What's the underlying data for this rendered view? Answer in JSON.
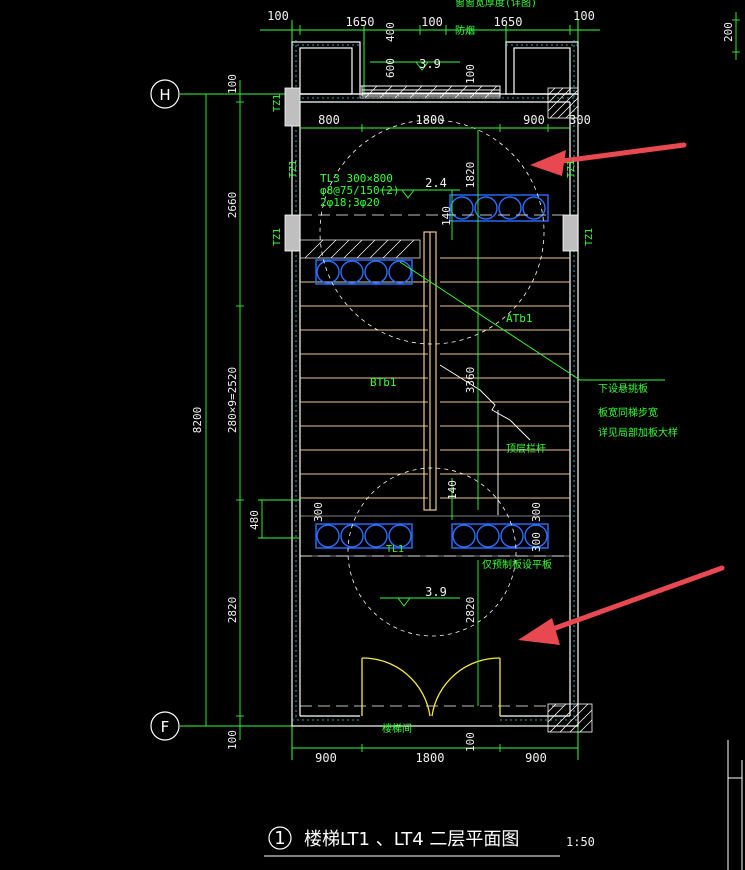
{
  "drawing": {
    "title_number": "1",
    "title": "楼梯LT1 、LT4  二层平面图",
    "scale": "1:50"
  },
  "axes": {
    "top": "H",
    "bottom": "F"
  },
  "top_dims": [
    "100",
    "1650",
    "100",
    "1650",
    "100"
  ],
  "top_inner_dims": [
    "800",
    "1800",
    "900",
    "300"
  ],
  "bottom_dims": [
    "900",
    "1800",
    "900"
  ],
  "left_dims": {
    "total": "8200",
    "top_100": "100",
    "seg1": "2660",
    "seg2": "280×9=2520",
    "seg3": "2820",
    "bottom_100": "100",
    "small": "480"
  },
  "window_dims": [
    "400",
    "600",
    "100"
  ],
  "right_dim": "200",
  "elevations": {
    "top": "3.9",
    "landing": "2.4",
    "bottom": "3.9"
  },
  "center_dims": [
    "1820",
    "3360",
    "2820",
    "100"
  ],
  "flight_dims": [
    "140",
    "140",
    "300",
    "300",
    "300"
  ],
  "beam_note": [
    "TL3 300×800",
    "φ8@75/150(2)",
    "2φ18;3φ20"
  ],
  "labels": {
    "atb": "ATb1",
    "btb": "BTb1",
    "tl1": "TL1",
    "tz1": "TZ1",
    "note1": "下设悬挑板",
    "note2": "板宽同梯步宽",
    "note3": "详见局部加板大样",
    "handrail": "顶层栏杆",
    "floor_note": "仅预制板设平板",
    "bottom_wall": "楼梯间",
    "top_partial": "窗窗宽厚度(详图)",
    "window_label": "防烟"
  },
  "colors": {
    "wall": "#ffffff",
    "dim": "#33ff33",
    "stair": "#e8c98a",
    "circle": "#2a6fff",
    "arrow": "#e8484f",
    "text": "#f2f2f2"
  }
}
